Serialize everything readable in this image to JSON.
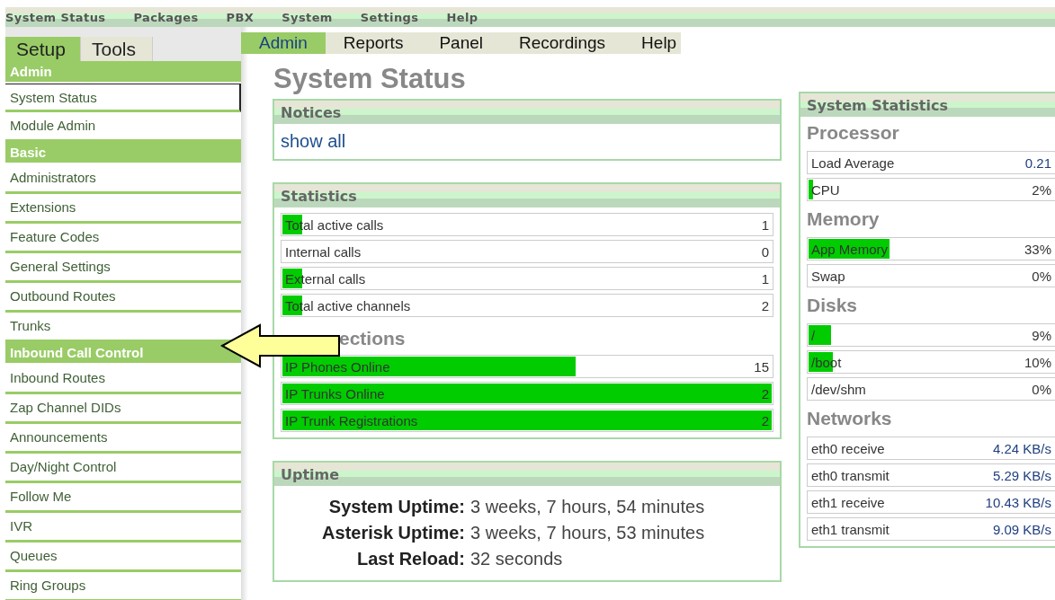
{
  "top_menu": [
    {
      "label": "System Status"
    },
    {
      "label": "Packages"
    },
    {
      "label": "PBX"
    },
    {
      "label": "System"
    },
    {
      "label": "Settings"
    },
    {
      "label": "Help"
    }
  ],
  "module_tabs": [
    {
      "label": "Admin",
      "selected": true
    },
    {
      "label": "Reports",
      "selected": false
    },
    {
      "label": "Panel",
      "selected": false
    },
    {
      "label": "Recordings",
      "selected": false
    },
    {
      "label": "Help",
      "selected": false
    }
  ],
  "sidebar": {
    "tabs": [
      {
        "label": "Setup",
        "selected": true
      },
      {
        "label": "Tools",
        "selected": false
      }
    ],
    "items": [
      {
        "kind": "header",
        "label": "Admin"
      },
      {
        "kind": "link",
        "label": "System Status",
        "selected": true
      },
      {
        "kind": "link",
        "label": "Module Admin",
        "selected": false
      },
      {
        "kind": "header",
        "label": "Basic"
      },
      {
        "kind": "link",
        "label": "Administrators",
        "selected": false
      },
      {
        "kind": "link",
        "label": "Extensions",
        "selected": false
      },
      {
        "kind": "link",
        "label": "Feature Codes",
        "selected": false
      },
      {
        "kind": "link",
        "label": "General Settings",
        "selected": false
      },
      {
        "kind": "link",
        "label": "Outbound Routes",
        "selected": false
      },
      {
        "kind": "link",
        "label": "Trunks",
        "selected": false
      },
      {
        "kind": "header",
        "label": "Inbound Call Control"
      },
      {
        "kind": "link",
        "label": "Inbound Routes",
        "selected": false
      },
      {
        "kind": "link",
        "label": "Zap Channel DIDs",
        "selected": false
      },
      {
        "kind": "link",
        "label": "Announcements",
        "selected": false
      },
      {
        "kind": "link",
        "label": "Day/Night Control",
        "selected": false
      },
      {
        "kind": "link",
        "label": "Follow Me",
        "selected": false
      },
      {
        "kind": "link",
        "label": "IVR",
        "selected": false
      },
      {
        "kind": "link",
        "label": "Queues",
        "selected": false
      },
      {
        "kind": "link",
        "label": "Ring Groups",
        "selected": false
      }
    ]
  },
  "page_title": "System Status",
  "notices": {
    "title": "Notices",
    "link": "show all"
  },
  "statistics": {
    "title": "Statistics",
    "rows": [
      {
        "label": "Total active calls",
        "value": "1",
        "level": 0.04
      },
      {
        "label": "Internal calls",
        "value": "0"
      },
      {
        "label": "External calls",
        "value": "1",
        "level": 0.04
      },
      {
        "label": "Total active channels",
        "value": "2",
        "level": 0.04
      }
    ],
    "connections_heading": "ections",
    "connections": [
      {
        "label": "IP Phones Online",
        "value": "15",
        "level": 0.6
      },
      {
        "label": "IP Trunks Online",
        "value": "2",
        "level": 1
      },
      {
        "label": "IP Trunk Registrations",
        "value": "2",
        "level": 1
      }
    ]
  },
  "uptime": {
    "title": "Uptime",
    "rows": [
      {
        "label": "System Uptime:",
        "value": "3 weeks, 7 hours, 54 minutes"
      },
      {
        "label": "Asterisk Uptime:",
        "value": "3 weeks, 7 hours, 53 minutes"
      },
      {
        "label": "Last Reload:",
        "value": "32 seconds"
      }
    ]
  },
  "system_statistics": {
    "title": "System Statistics",
    "groups": [
      {
        "heading": "Processor",
        "rows": [
          {
            "kind": "reading",
            "label": "Load Average",
            "value": "0.21"
          },
          {
            "kind": "meter",
            "label": "CPU",
            "value": "2%",
            "level": 0.02
          }
        ]
      },
      {
        "heading": "Memory",
        "rows": [
          {
            "kind": "meter",
            "label": "App Memory",
            "value": "33%",
            "level": 0.33
          },
          {
            "kind": "meter",
            "label": "Swap",
            "value": "0%"
          }
        ]
      },
      {
        "heading": "Disks",
        "rows": [
          {
            "kind": "meter",
            "label": "/",
            "value": "9%",
            "level": 0.09
          },
          {
            "kind": "meter",
            "label": "/boot",
            "value": "10%",
            "level": 0.1
          },
          {
            "kind": "meter",
            "label": "/dev/shm",
            "value": "0%"
          }
        ]
      },
      {
        "heading": "Networks",
        "rows": [
          {
            "kind": "reading",
            "label": "eth0 receive",
            "value": "4.24 KB/s"
          },
          {
            "kind": "reading",
            "label": "eth0 transmit",
            "value": "5.29 KB/s"
          },
          {
            "kind": "reading",
            "label": "eth1 receive",
            "value": "10.43 KB/s"
          },
          {
            "kind": "reading",
            "label": "eth1 transmit",
            "value": "9.09 KB/s"
          }
        ]
      }
    ]
  }
}
